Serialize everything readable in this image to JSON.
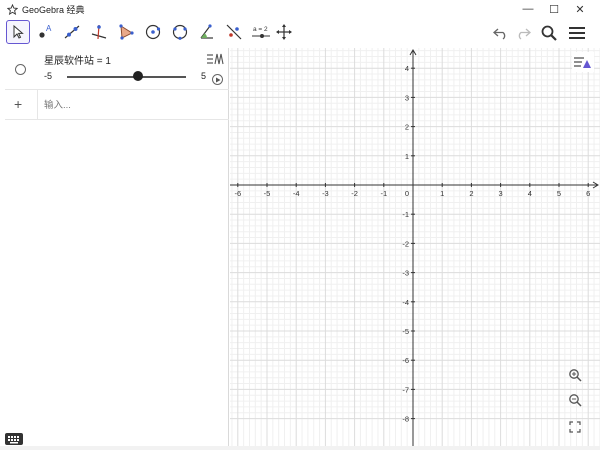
{
  "window": {
    "title": "GeoGebra 经典",
    "minimize": "—",
    "maximize": "☐",
    "close": "✕"
  },
  "toolbar": {
    "tools": [
      {
        "name": "move-tool",
        "icon": "arrow-cursor-icon",
        "active": true
      },
      {
        "name": "point-tool",
        "icon": "point-icon"
      },
      {
        "name": "line-tool",
        "icon": "line-icon"
      },
      {
        "name": "perpendicular-tool",
        "icon": "perpendicular-icon"
      },
      {
        "name": "polygon-tool",
        "icon": "polygon-icon"
      },
      {
        "name": "circle-tool",
        "icon": "circle-icon"
      },
      {
        "name": "conic-tool",
        "icon": "conic-icon"
      },
      {
        "name": "angle-tool",
        "icon": "angle-icon"
      },
      {
        "name": "reflect-tool",
        "icon": "reflect-icon"
      },
      {
        "name": "slider-tool",
        "icon": "slider-icon",
        "label": "a = 2"
      },
      {
        "name": "move-graphics-tool",
        "icon": "move-view-icon"
      }
    ],
    "undo_icon": "undo-icon",
    "redo_icon": "redo-icon",
    "search_icon": "search-icon",
    "menu_icon": "hamburger-menu-icon"
  },
  "algebra": {
    "slider_definition": "星辰软件站 = 1",
    "slider_min": "-5",
    "slider_max": "5",
    "slider_value": 1,
    "input_placeholder": "输入..."
  },
  "graphics": {
    "x_range": [
      -6,
      6
    ],
    "y_range": [
      -8,
      4
    ],
    "x_ticks": [
      "-6",
      "-5",
      "-4",
      "-3",
      "-2",
      "-1",
      "0",
      "1",
      "2",
      "3",
      "4",
      "5",
      "6"
    ],
    "y_ticks": [
      "4",
      "3",
      "2",
      "1",
      "-1",
      "-2",
      "-3",
      "-4",
      "-5",
      "-6",
      "-7",
      "-8"
    ],
    "grid": true,
    "zoom_in_icon": "zoom-in-icon",
    "zoom_out_icon": "zoom-out-icon",
    "fullscreen_icon": "fullscreen-icon",
    "style_bar_icon": "style-bar-icon"
  },
  "colors": {
    "accent": "#6557d2",
    "grid_major": "#dcdcdc",
    "grid_minor": "#f0f0f0",
    "axis": "#333333"
  }
}
